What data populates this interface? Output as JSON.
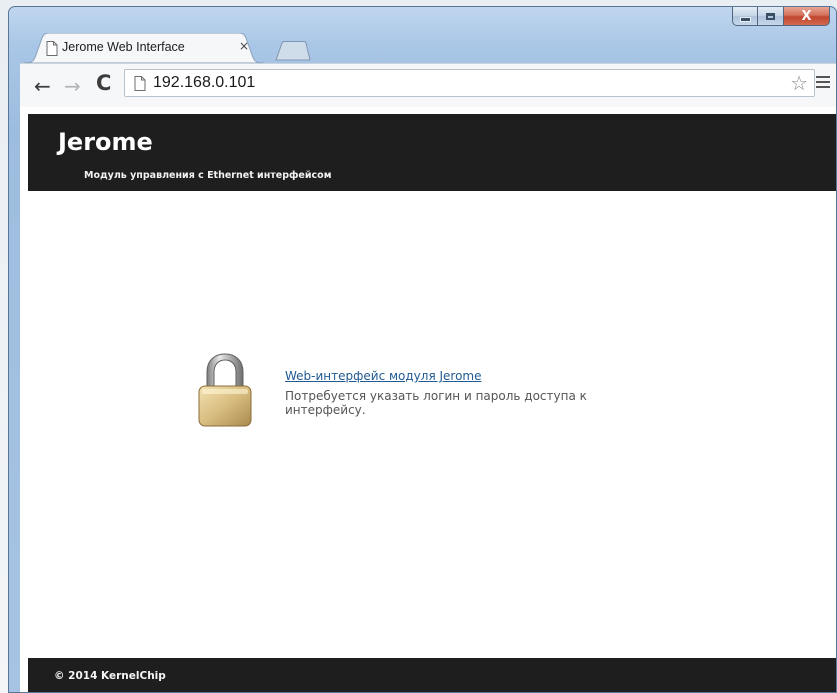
{
  "browser": {
    "tab": {
      "title": "Jerome Web Interface",
      "close_glyph": "×",
      "icon": "page-icon"
    },
    "new_tab_icon": "new-tab-icon",
    "nav": {
      "back_glyph": "←",
      "forward_glyph": "→",
      "reload_glyph": "C"
    },
    "address": {
      "url": "192.168.0.101",
      "star_glyph": "☆"
    },
    "window_buttons": {
      "close_glyph": "X"
    }
  },
  "site": {
    "title": "Jerome",
    "subtitle": "Модуль управления с Ethernet интерфейсом",
    "login_link": "Web-интерфейс модуля Jerome",
    "login_description": "Потребуется указать логин и пароль доступа к интерфейсу.",
    "lock_icon": "lock-icon",
    "footer": "© 2014 KernelChip"
  },
  "colors": {
    "header_bg": "#1e1e1e",
    "link": "#1f5a93",
    "window_close": "#c2452d"
  }
}
